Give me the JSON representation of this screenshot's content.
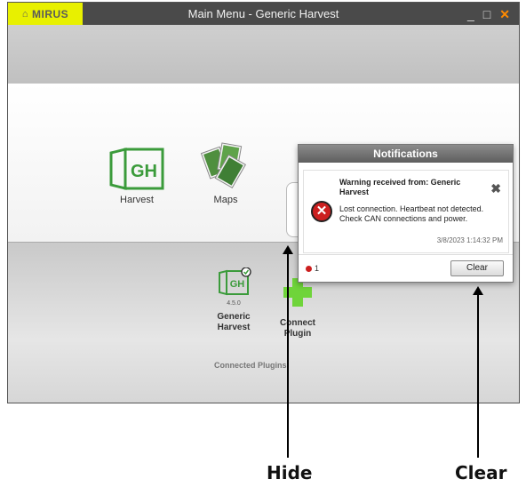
{
  "window": {
    "title": "Main Menu - Generic Harvest",
    "logo_text": "MIRUS",
    "controls": {
      "minimize": "_",
      "maximize": "□",
      "close": "✕"
    }
  },
  "apps": [
    {
      "label": "Harvest",
      "icon": "gh-harvest-icon"
    },
    {
      "label": "Maps",
      "icon": "maps-icon"
    }
  ],
  "plugins": {
    "items": [
      {
        "name_line1": "Generic",
        "name_line2": "Harvest",
        "version": "4.5.0",
        "status": "connected"
      },
      {
        "name_line1": "Connect",
        "name_line2": "Plugin",
        "version": "",
        "status": "add"
      }
    ],
    "section_label": "Connected Plugins"
  },
  "notifications": {
    "header": "Notifications",
    "item": {
      "title": "Warning received from: Generic Harvest",
      "body": "Lost connection. Heartbeat not detected. Check CAN connections and power.",
      "timestamp": "3/8/2023 1:14:32 PM",
      "severity": "error"
    },
    "error_count": "1",
    "clear_label": "Clear"
  },
  "annotations": {
    "hide_label": "Hide",
    "clear_label": "Clear"
  },
  "colors": {
    "brand_yellow": "#e8f000",
    "gh_green": "#3b9b3b",
    "plus_green": "#6fd43a",
    "error_red": "#cc1f1f",
    "close_orange": "#ff8a00"
  }
}
